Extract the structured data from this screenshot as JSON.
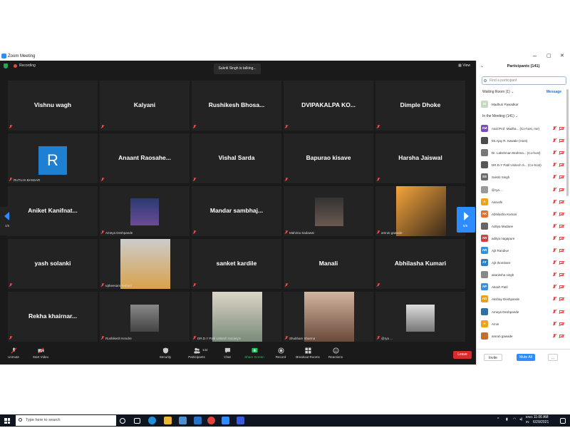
{
  "window": {
    "title": "Zoom Meeting",
    "controls": [
      "–",
      "▢",
      "✕"
    ]
  },
  "topbar": {
    "recording_label": "Recording",
    "talking_text": "Sukriti Singh is talking...",
    "view_label": "View"
  },
  "grid": {
    "tiles": [
      {
        "name": "Vishnu wagh",
        "caption": ""
      },
      {
        "name": "Kalyani",
        "caption": ""
      },
      {
        "name": "Rushikesh  Bhosa...",
        "caption": ""
      },
      {
        "name": "DVIPAKALPA  KO...",
        "caption": ""
      },
      {
        "name": "Dimple Dhoke",
        "caption": ""
      },
      {
        "name": "",
        "caption": "RUTUJA BANSAR",
        "avatar": "R"
      },
      {
        "name": "Anaant  Raosahe...",
        "caption": ""
      },
      {
        "name": "Vishal Sarda",
        "caption": ""
      },
      {
        "name": "Bapurao kisave",
        "caption": ""
      },
      {
        "name": "Harsha Jaiswal",
        "caption": ""
      },
      {
        "name": "Aniket  Kanifnat...",
        "caption": ""
      },
      {
        "name": "",
        "caption": "Ameya Deshpande",
        "video": "poster"
      },
      {
        "name": "Mandar  sambhaj...",
        "caption": ""
      },
      {
        "name": "",
        "caption": "Mahima Sadawat",
        "video": "portrait"
      },
      {
        "name": "",
        "caption": "amruti gawade",
        "video": "flowers"
      },
      {
        "name": "yash solanki",
        "caption": ""
      },
      {
        "name": "",
        "caption": "Iqtheesam Taribeti",
        "video": "person"
      },
      {
        "name": "sanket kardile",
        "caption": ""
      },
      {
        "name": "Manali",
        "caption": ""
      },
      {
        "name": "Abhilasha Kumari",
        "caption": ""
      },
      {
        "name": "Rekha  khairnar...",
        "caption": ""
      },
      {
        "name": "",
        "caption": "Rushikesh Kendre",
        "video": "gym"
      },
      {
        "name": "",
        "caption": "DR.D.Y Patil Unitech Society's",
        "video": "room"
      },
      {
        "name": "",
        "caption": "Shubham Sharma",
        "video": "face"
      },
      {
        "name": "",
        "caption": "@rya ...",
        "video": "sketch"
      }
    ],
    "page_left": "3/6",
    "page_right": "5/6"
  },
  "toolbar": {
    "unmute": "Unmute",
    "start_video": "Start Video",
    "security": "Security",
    "participants": "Participants",
    "participants_count": "142",
    "chat": "Chat",
    "share_screen": "Share Screen",
    "record": "Record",
    "breakout": "Breakout Rooms",
    "reactions": "Reactions",
    "leave": "Leave"
  },
  "panel": {
    "title": "Participants (141)",
    "search_placeholder": "Find a participant",
    "waiting_room_label": "Waiting Room (1)",
    "message_label": "Message",
    "waiting": {
      "initials": "M",
      "name": "Madhuri Pawadkar"
    },
    "in_meeting_label": "In the Meeting (141)",
    "participants": [
      {
        "initials": "AM",
        "name": "Asst.Prof. Madha...  (Co-host, me)",
        "color": "#7a4fb5"
      },
      {
        "initials": "",
        "name": "Mr.Ajay R. Kawale (Host)",
        "color": "#4a4a4a"
      },
      {
        "initials": "",
        "name": "Dr. Lakshman Brahma...  (Co-host)",
        "color": "#777777"
      },
      {
        "initials": "",
        "name": "DR.D.Y Patil Unitech S...  (Co-host)",
        "color": "#555555"
      },
      {
        "initials": "SS",
        "name": "Sukriti Singh",
        "color": "#6b6b6b"
      },
      {
        "initials": "",
        "name": "@rya ...",
        "color": "#999999"
      },
      {
        "initials": "A",
        "name": "Aarushi",
        "color": "#f0a020"
      },
      {
        "initials": "AK",
        "name": "Abhilasha Kumari",
        "color": "#e07030"
      },
      {
        "initials": "",
        "name": "Aditya Madane",
        "color": "#666666"
      },
      {
        "initials": "AN",
        "name": "aditya nagapure",
        "color": "#d14040"
      },
      {
        "initials": "AR",
        "name": "Ajit Randive",
        "color": "#3a8fd8"
      },
      {
        "initials": "AT",
        "name": "Ajit thombare",
        "color": "#2c7fc8"
      },
      {
        "initials": "",
        "name": "akanksha singh",
        "color": "#888888"
      },
      {
        "initials": "AP",
        "name": "Akash Patil",
        "color": "#3a8fd8"
      },
      {
        "initials": "AD",
        "name": "Akshay Deshpande",
        "color": "#e8a020"
      },
      {
        "initials": "",
        "name": "Ameya Deshpande",
        "color": "#3070a0"
      },
      {
        "initials": "A",
        "name": "Amin",
        "color": "#f0a020"
      },
      {
        "initials": "",
        "name": "amruti gawade",
        "color": "#c07030"
      }
    ],
    "invite": "Invite",
    "mute_all": "Mute All",
    "more": "..."
  },
  "taskbar": {
    "search_placeholder": "Type here to search",
    "lang_top": "ENG",
    "lang_bottom": "IN",
    "time": "11:06 AM",
    "date": "6/29/2021"
  }
}
